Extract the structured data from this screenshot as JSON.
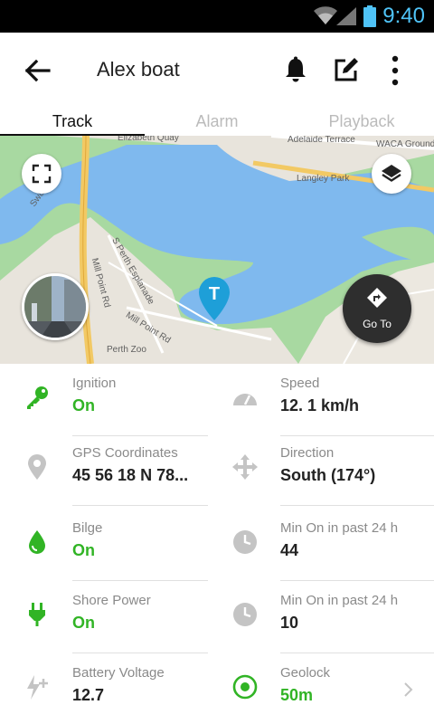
{
  "status_bar": {
    "time": "9:40",
    "accent": "#4fc3f7"
  },
  "app_bar": {
    "title": "Alex boat",
    "icons": [
      "back-arrow-icon",
      "bell-icon",
      "edit-icon",
      "more-vertical-icon"
    ]
  },
  "tabs": [
    {
      "label": "Track",
      "active": true
    },
    {
      "label": "Alarm",
      "active": false
    },
    {
      "label": "Playback",
      "active": false
    }
  ],
  "map": {
    "labels": [
      "Elizabeth Quay",
      "Adelaide Terrace",
      "WACA Ground",
      "Langley Park",
      "Swan River",
      "Mill Point Rd",
      "S Perth Esplanade",
      "Mill Point Rd",
      "Perth Zoo"
    ],
    "marker_letter": "T",
    "goto_label": "Go To",
    "colors": {
      "water": "#7fb9ee",
      "land": "#a8d9a1",
      "road": "#f2c964",
      "urban": "#e8e4dc",
      "marker": "#1e9fd8"
    }
  },
  "details": {
    "left": [
      {
        "label": "Ignition",
        "value": "On",
        "value_color": "green",
        "icon": "key-icon"
      },
      {
        "label": "GPS Coordinates",
        "value": "45 56 18 N 78...",
        "value_color": "dark",
        "icon": "location-pin-icon"
      },
      {
        "label": "Bilge",
        "value": "On",
        "value_color": "green",
        "icon": "water-drop-icon"
      },
      {
        "label": "Shore Power",
        "value": "On",
        "value_color": "green",
        "icon": "plug-icon"
      },
      {
        "label": "Battery Voltage",
        "value": "12.7",
        "value_color": "dark",
        "icon": "battery-charge-icon"
      }
    ],
    "right": [
      {
        "label": "Speed",
        "value": "12. 1 km/h",
        "value_color": "dark",
        "icon": "speedometer-icon"
      },
      {
        "label": "Direction",
        "value": "South (174°)",
        "value_color": "dark",
        "icon": "move-arrows-icon"
      },
      {
        "label": "Min On in past 24 h",
        "value": "44",
        "value_color": "dark",
        "icon": "clock-icon"
      },
      {
        "label": "Min On in past 24 h",
        "value": "10",
        "value_color": "dark",
        "icon": "clock-icon"
      },
      {
        "label": "Geolock",
        "value": "50m",
        "value_color": "green",
        "icon": "geolock-target-icon"
      }
    ],
    "colors": {
      "green": "#31b425",
      "grey_icon": "#c4c4c4"
    }
  }
}
